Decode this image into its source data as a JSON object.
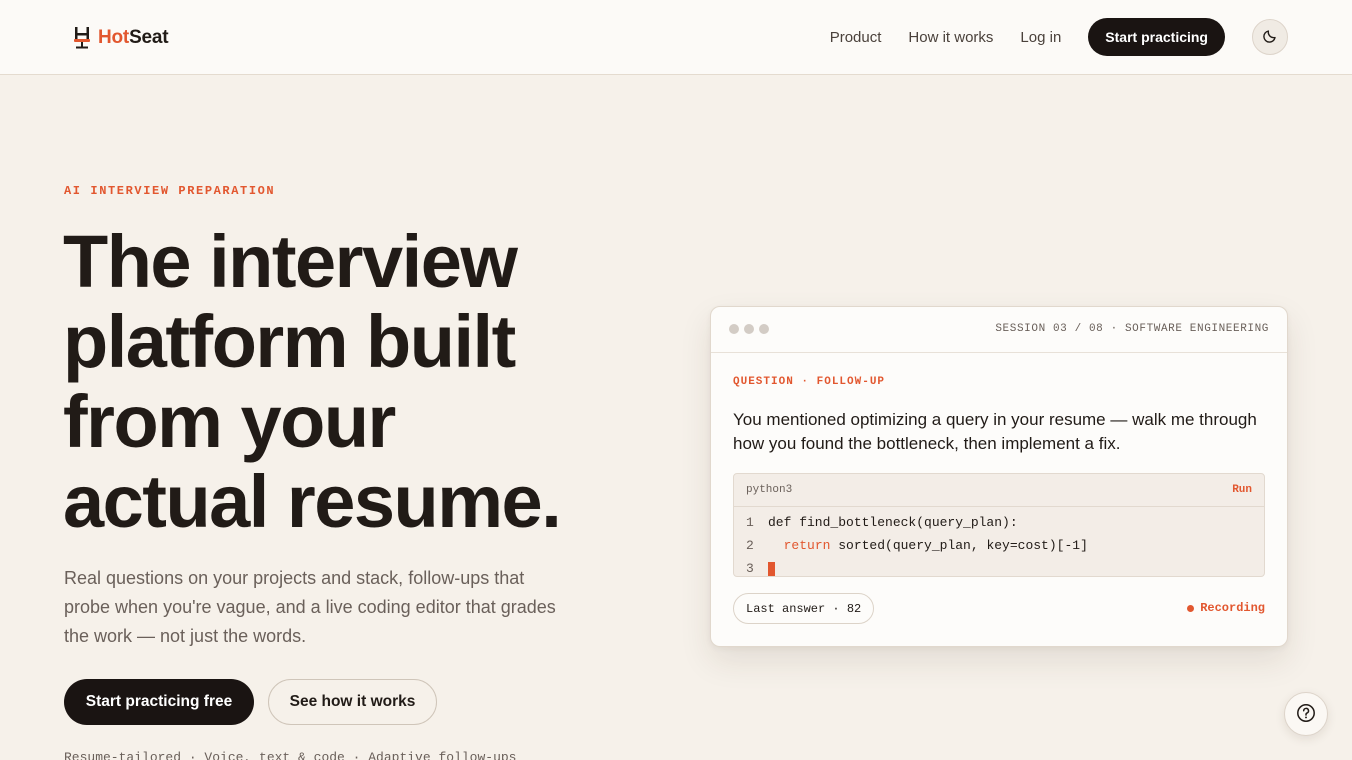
{
  "header": {
    "logo_hot": "Hot",
    "logo_seat": "Seat",
    "nav": [
      "Product",
      "How it works",
      "Log in"
    ],
    "cta": "Start practicing",
    "theme_icon": "moon-icon"
  },
  "hero": {
    "eyebrow": "AI INTERVIEW PREPARATION",
    "headline_lines": [
      "The interview",
      "platform built",
      "from your",
      "actual resume."
    ],
    "subcopy": "Real questions on your projects and stack, follow-ups that probe when you're vague, and a live coding editor that grades the work — not just the words.",
    "primary_button": "Start practicing free",
    "secondary_button": "See how it works",
    "features": "Resume-tailored · Voice, text & code · Adaptive follow-ups"
  },
  "card": {
    "session": "SESSION 03 / 08 · SOFTWARE ENGINEERING",
    "question_label": "QUESTION · FOLLOW-UP",
    "question_text": "You mentioned optimizing a query in your resume — walk me through how you found the bottleneck, then implement a fix.",
    "editor": {
      "language": "python3",
      "run_label": "Run",
      "lines": [
        {
          "n": "1",
          "keyword": "",
          "text": "def find_bottleneck(query_plan):"
        },
        {
          "n": "2",
          "keyword": "return",
          "text": " sorted(query_plan, key=cost)[-1]"
        },
        {
          "n": "3",
          "keyword": "",
          "text": ""
        }
      ]
    },
    "last_answer": "Last answer · 82",
    "recording": "Recording"
  },
  "help_icon": "question-mark-icon",
  "colors": {
    "accent": "#e2572f",
    "dark": "#1a1412",
    "background": "#f6f1ea"
  }
}
